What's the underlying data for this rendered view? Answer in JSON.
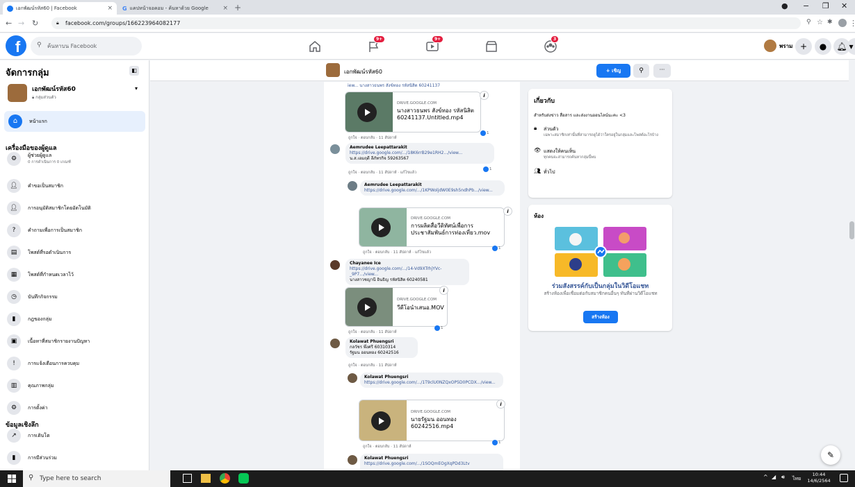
{
  "browser": {
    "tabs": [
      {
        "title": "เอกพัฒน์รหัส60 | Facebook"
      },
      {
        "title": "แคปหน้าจอคอม - ค้นหาด้วย Google"
      }
    ],
    "url": "facebook.com/groups/166223964082177"
  },
  "fb_header": {
    "logo": "f",
    "search_placeholder": "ค้นหาบน Facebook",
    "badges": {
      "flag": "9+",
      "watch": "9+",
      "groups": "3"
    },
    "user_name": "พราม"
  },
  "left_sidebar": {
    "title": "จัดการกลุ่ม",
    "group_name": "เอกพัฒน์รหัส60",
    "group_privacy": "กลุ่มส่วนตัว",
    "home": "หน้าแรก",
    "admin_tools_heading": "เครื่องมือของผู้ดูแล",
    "admin_items": [
      {
        "label": "ผู้ช่วยผู้ดูแล",
        "sub": "0 การดำเนินการ 0 เกณฑ์"
      },
      {
        "label": "คำขอเป็นสมาชิก"
      },
      {
        "label": "การอนุมัติสมาชิกโดยอัตโนมัติ"
      },
      {
        "label": "คำถามเพื่อการเป็นสมาชิก"
      },
      {
        "label": "โพสต์ที่รอดำเนินการ"
      },
      {
        "label": "โพสต์ที่กำหนดเวลาไว้"
      },
      {
        "label": "บันทึกกิจกรรม"
      },
      {
        "label": "กฎของกลุ่ม"
      },
      {
        "label": "เนื้อหาที่สมาชิกรายงานปัญหา"
      },
      {
        "label": "การแจ้งเตือนการควบคุม"
      },
      {
        "label": "คุณภาพกลุ่ม"
      },
      {
        "label": "การตั้งค่า"
      }
    ],
    "insights_heading": "ข้อมูลเชิงลึก",
    "insight_items": [
      {
        "label": "การเติบโต"
      },
      {
        "label": "การมีส่วนร่วม"
      }
    ]
  },
  "group_bar": {
    "group_name": "เอกพัฒน์รหัส60",
    "invite_label": "+ เชิญ",
    "more": "···"
  },
  "feed": {
    "top_text": "iew... นางสาวธนพร สังข์ทอง รหัสนิสิต 60241137",
    "comments": [
      {
        "link_domain": "DRIVE.GOOGLE.COM",
        "link_title": "นางสาวธนพร สังข์ทอง รหัสนิสิต 60241137.Untitled.mp4",
        "meta": "ถูกใจ · ตอบกลับ · 11 สัปดาห์",
        "reactions": "1"
      },
      {
        "name": "Aemrudee Leepattarakit",
        "link": "https://drive.google.com/.../18K6rrB29e1RH2.../view...",
        "text": "น.ส.เอมฤดี ลีภัทรกิจ 59263567",
        "meta": "ถูกใจ · ตอบกลับ · 11 สัปดาห์ · แก้ไขแล้ว",
        "reactions": "1"
      },
      {
        "name": "Aemrudee Leepattarakit",
        "link": "https://drive.google.com/.../1KPWoljdW0E9sh5ndhPb.../view...",
        "link_domain": "DRIVE.GOOGLE.COM",
        "link_title": "การผลิตสื่อวีดิทัศน์เพื่อการประชาสัมพันธ์การท่องเที่ยว.mov",
        "meta": "ถูกใจ · ตอบกลับ · 11 สัปดาห์ · แก้ไขแล้ว",
        "reactions": "1"
      },
      {
        "name": "Chayanee Ice",
        "link": "https://drive.google.com/.../14-Vd9XTrhjYVc-_9P7.../view...",
        "text": "นางสาวชญานี อินธิญ รหัสนิสิต 60240581",
        "link_domain": "DRIVE.GOOGLE.COM",
        "link_title": "วีดีโอนำเสนอ.MOV",
        "meta": "ถูกใจ · ตอบกลับ · 11 สัปดาห์",
        "reactions": "1"
      },
      {
        "name": "Kolawat Phuengsri",
        "text1": "กลวัชร พึ่งศรี 60310314",
        "text2": "รัฐมน ออนทอง 60242516",
        "meta": "ถูกใจ · ตอบกลับ · 11 สัปดาห์"
      },
      {
        "name": "Kolawat Phuengsri",
        "link": "https://drive.google.com/.../1T9clU0NZQxOP5D0PCDX.../view...",
        "link_domain": "DRIVE.GOOGLE.COM",
        "link_title": "นายรัฐมน ออนทอง 60242516.mp4",
        "meta": "ถูกใจ · ตอบกลับ · 11 สัปดาห์",
        "reactions": "1"
      },
      {
        "name": "Kolawat Phuengsri",
        "link": "https://drive.google.com/.../1SOQmEOgXqPDd3Ltv"
      }
    ]
  },
  "about": {
    "title": "เกี่ยวกับ",
    "desc": "สำหรับส่งข่าว สื่อสาร และส่งงานออนไลน์นะคะ <3",
    "private_title": "ส่วนตัว",
    "private_desc": "เฉพาะสมาชิกเท่านั้นที่สามารถดูได้ว่าใครอยู่ในกลุ่มและโพสต์อะไรบ้าง",
    "visible_title": "แสดงให้คนเห็น",
    "visible_desc": "ทุกคนจะสามารถค้นหากลุ่มนี้พบ",
    "general": "ทั่วไป"
  },
  "rooms": {
    "title": "ห้อง",
    "headline": "ร่วมสังสรรค์กับเป็นกลุ่มในวิดีโอแชท",
    "desc": "สร้างห้องเพื่อเชื่อมต่อกับสมาชิกคนอื่นๆ ทันทีผ่านวิดีโอแชท",
    "button": "สร้างห้อง"
  },
  "taskbar": {
    "search_placeholder": "Type here to search",
    "lang": "ไทย",
    "time": "10:44",
    "date": "14/6/2564"
  }
}
